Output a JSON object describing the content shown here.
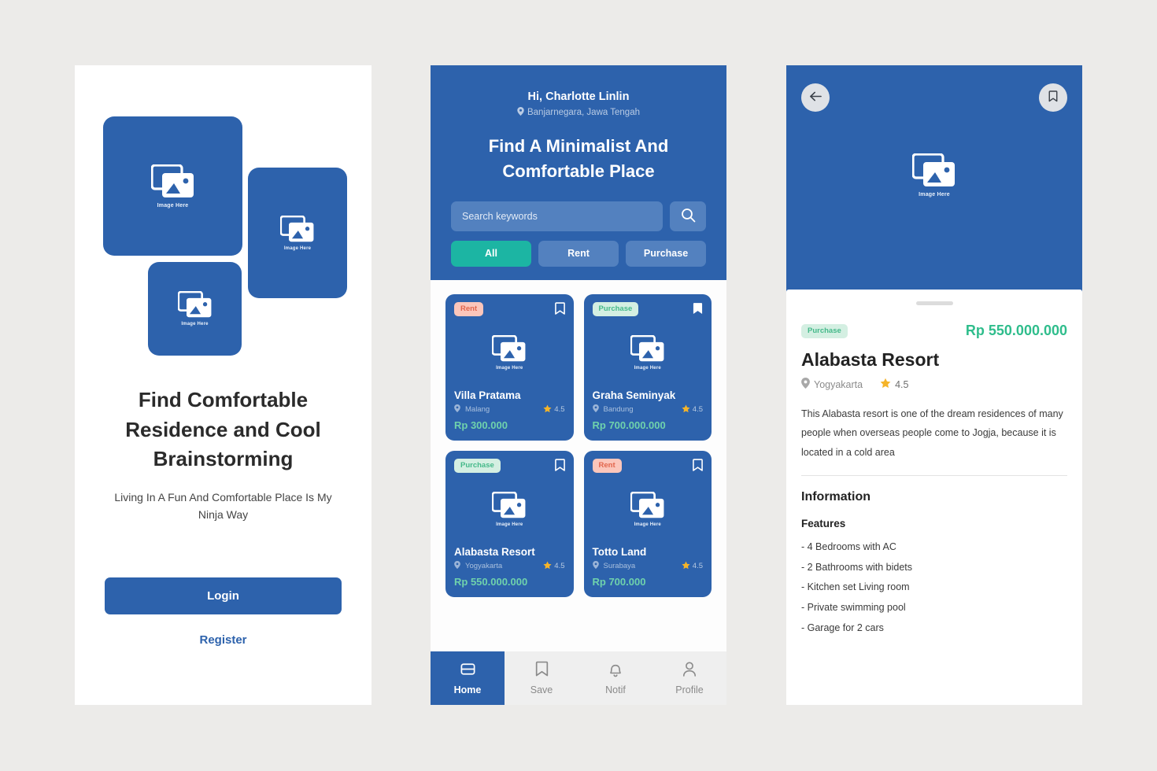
{
  "colors": {
    "brand_blue": "#2d62ac",
    "accent_teal": "#1cb5a3",
    "price_green": "#2fbd8c",
    "page_bg": "#ecebe9",
    "badge_rent_bg": "#fbc6bb",
    "badge_rent_text": "#e2654c",
    "badge_purchase_bg": "#d4efe2",
    "badge_purchase_text": "#45b98a"
  },
  "onboarding": {
    "placeholders": [
      {
        "caption": "Image Here",
        "name": "image-placeholder-large"
      },
      {
        "caption": "Image Here",
        "name": "image-placeholder-tall"
      },
      {
        "caption": "Image Here",
        "name": "image-placeholder-small"
      }
    ],
    "title": "Find Comfortable Residence and Cool Brainstorming",
    "subtitle": "Living In A Fun And Comfortable Place Is My Ninja Way",
    "login_label": "Login",
    "register_label": "Register"
  },
  "home": {
    "greeting": "Hi, Charlotte Linlin",
    "location": "Banjarnegara, Jawa Tengah",
    "location_icon": "map-pin-icon",
    "headline": "Find A Minimalist And Comfortable Place",
    "search": {
      "placeholder": "Search keywords",
      "value": "",
      "button_icon": "search-icon"
    },
    "filters": [
      {
        "label": "All",
        "active": true
      },
      {
        "label": "Rent",
        "active": false
      },
      {
        "label": "Purchase",
        "active": false
      }
    ],
    "cards": [
      {
        "badge": "Rent",
        "badge_type": "rent",
        "bookmarked": false,
        "image_caption": "Image Here",
        "name": "Villa Pratama",
        "location": "Malang",
        "rating": "4.5",
        "price": "Rp 300.000"
      },
      {
        "badge": "Purchase",
        "badge_type": "purchase",
        "bookmarked": true,
        "image_caption": "Image Here",
        "name": "Graha Seminyak",
        "location": "Bandung",
        "rating": "4.5",
        "price": "Rp 700.000.000"
      },
      {
        "badge": "Purchase",
        "badge_type": "purchase",
        "bookmarked": false,
        "image_caption": "Image Here",
        "name": "Alabasta Resort",
        "location": "Yogyakarta",
        "rating": "4.5",
        "price": "Rp 550.000.000"
      },
      {
        "badge": "Rent",
        "badge_type": "rent",
        "bookmarked": false,
        "image_caption": "Image Here",
        "name": "Totto Land",
        "location": "Surabaya",
        "rating": "4.5",
        "price": "Rp 700.000"
      }
    ],
    "tabs": [
      {
        "label": "Home",
        "icon": "home-icon",
        "active": true
      },
      {
        "label": "Save",
        "icon": "bookmark-icon",
        "active": false
      },
      {
        "label": "Notif",
        "icon": "bell-icon",
        "active": false
      },
      {
        "label": "Profile",
        "icon": "user-icon",
        "active": false
      }
    ]
  },
  "detail": {
    "back_icon": "arrow-left-icon",
    "bookmark_icon": "bookmark-icon",
    "hero_caption": "Image Here",
    "badge": "Purchase",
    "price": "Rp 550.000.000",
    "title": "Alabasta Resort",
    "location": "Yogyakarta",
    "rating": "4.5",
    "description": "This Alabasta resort is one of the dream residences of many people when overseas people come to Jogja, because it is located in a cold area",
    "information_heading": "Information",
    "features_heading": "Features",
    "features": [
      "- 4 Bedrooms with AC",
      "- 2 Bathrooms with bidets",
      "- Kitchen set Living room",
      "- Private swimming pool",
      "- Garage for 2 cars"
    ]
  }
}
